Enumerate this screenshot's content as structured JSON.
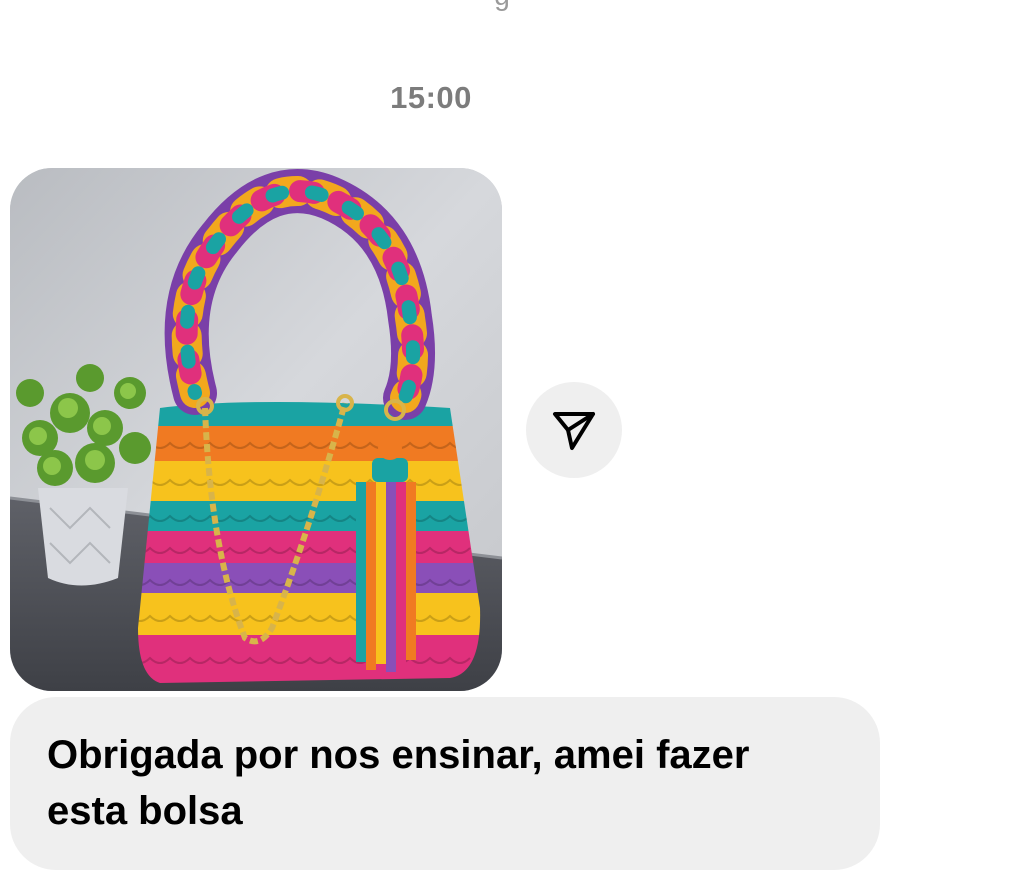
{
  "conversation": {
    "timestamp": "15:00",
    "messages": [
      {
        "type": "image",
        "alt": "photo-message",
        "share_icon": "send-icon"
      },
      {
        "type": "text",
        "text": "Obrigada por nos ensinar, amei fazer esta bolsa"
      }
    ]
  },
  "colors": {
    "background": "#ffffff",
    "bubble_background": "#efefef",
    "timestamp_text": "#7c7c7c",
    "message_text": "#000000"
  }
}
